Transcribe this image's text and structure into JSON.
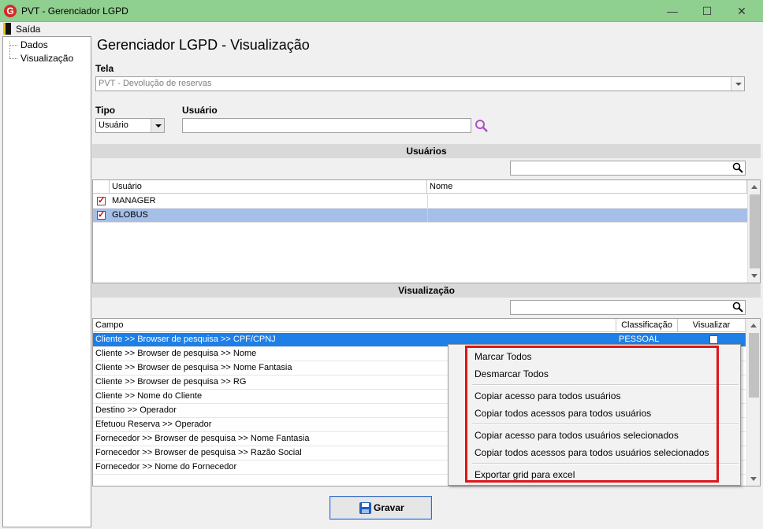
{
  "window": {
    "title": "PVT - Gerenciador LGPD",
    "icon_letter": "G"
  },
  "menu": {
    "exit_label": "Saída"
  },
  "tree": {
    "items": [
      "Dados",
      "Visualização"
    ]
  },
  "main": {
    "title": "Gerenciador LGPD - Visualização"
  },
  "tela": {
    "label": "Tela",
    "value": "PVT - Devolução de reservas"
  },
  "tipo": {
    "label": "Tipo",
    "value": "Usuário"
  },
  "usuario_field": {
    "label": "Usuário",
    "value": ""
  },
  "usuarios_section": {
    "title": "Usuários",
    "search_value": "",
    "columns": [
      "Usuário",
      "Nome"
    ],
    "rows": [
      {
        "checked": true,
        "usuario": "MANAGER",
        "nome": ""
      },
      {
        "checked": true,
        "usuario": "GLOBUS",
        "nome": ""
      }
    ]
  },
  "visualizacao_section": {
    "title": "Visualização",
    "search_value": "",
    "columns": [
      "Campo",
      "Classificação",
      "Visualizar"
    ],
    "rows": [
      {
        "campo": "Cliente >> Browser de pesquisa >> CPF/CPNJ",
        "classificacao": "PESSOAL",
        "visualizar": false
      },
      {
        "campo": "Cliente >> Browser de pesquisa >> Nome",
        "classificacao": "",
        "visualizar": false
      },
      {
        "campo": "Cliente >> Browser de pesquisa >> Nome Fantasia",
        "classificacao": "",
        "visualizar": false
      },
      {
        "campo": "Cliente >> Browser de pesquisa >> RG",
        "classificacao": "",
        "visualizar": false
      },
      {
        "campo": "Cliente >> Nome do Cliente",
        "classificacao": "",
        "visualizar": false
      },
      {
        "campo": "Destino >> Operador",
        "classificacao": "",
        "visualizar": false
      },
      {
        "campo": "Efetuou Reserva >> Operador",
        "classificacao": "",
        "visualizar": false
      },
      {
        "campo": "Fornecedor >> Browser de pesquisa >> Nome Fantasia",
        "classificacao": "",
        "visualizar": false
      },
      {
        "campo": "Fornecedor >> Browser de pesquisa >> Razão Social",
        "classificacao": "",
        "visualizar": false
      },
      {
        "campo": "Fornecedor >> Nome do Fornecedor",
        "classificacao": "",
        "visualizar": false
      }
    ]
  },
  "context_menu": {
    "items": [
      "Marcar Todos",
      "Desmarcar Todos",
      "Copiar acesso para todos usuários",
      "Copiar todos acessos para todos usuários",
      "Copiar acesso para todos usuários selecionados",
      "Copiar todos acessos para todos usuários selecionados",
      "Exportar grid para excel"
    ]
  },
  "footer": {
    "save_label": "Gravar"
  },
  "colors": {
    "titlebar": "#8fcf8f",
    "selection_blue": "#1e7fe6",
    "selection_light": "#a6bfe8",
    "highlight_red": "#e0141a"
  }
}
